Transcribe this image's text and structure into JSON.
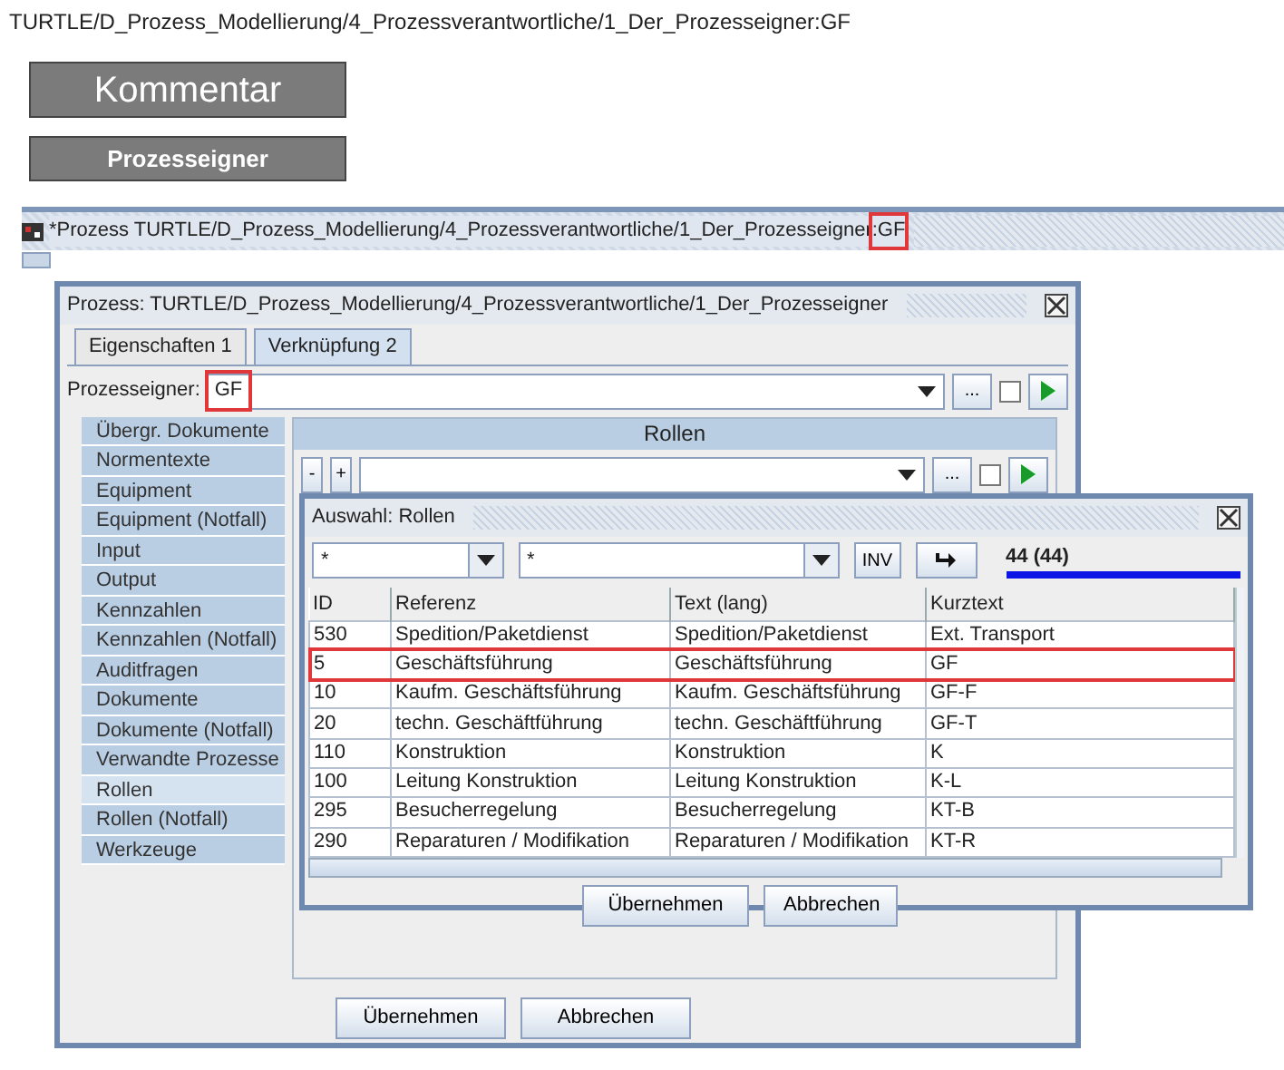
{
  "path_text": "TURTLE/D_Prozess_Modellierung/4_Prozessverantwortliche/1_Der_Prozesseigner:GF",
  "buttons": [
    {
      "label": "Kommentar",
      "kind": "large"
    },
    {
      "label": "Prozesseigner",
      "kind": "small"
    }
  ],
  "app_window": {
    "title": [
      {
        "text": "*Prozess TURTLE/D_Prozess_Modellierung/4_Prozessverantwortliche/1_Der_Prozesseigner",
        "highlighted": false
      },
      {
        "text": ":GF",
        "highlighted": true
      }
    ]
  },
  "process_dialog": {
    "title": "Prozess: TURTLE/D_Prozess_Modellierung/4_Prozessverantwortliche/1_Der_Prozesseigner",
    "tabs": [
      {
        "label": "Eigenschaften 1",
        "selected": false
      },
      {
        "label": "Verknüpfung 2",
        "selected": true
      }
    ],
    "owner_field": {
      "label": "Prozesseigner:",
      "value": "GF",
      "highlighted": true,
      "more_button": "...",
      "checked": false
    },
    "categories": [
      {
        "label": "Übergr. Dokumente",
        "selected": false
      },
      {
        "label": "Normentexte",
        "selected": false
      },
      {
        "label": "Equipment",
        "selected": false
      },
      {
        "label": "Equipment (Notfall)",
        "selected": false
      },
      {
        "label": "Input",
        "selected": false
      },
      {
        "label": "Output",
        "selected": false
      },
      {
        "label": "Kennzahlen",
        "selected": false
      },
      {
        "label": "Kennzahlen (Notfall)",
        "selected": false
      },
      {
        "label": "Auditfragen",
        "selected": false
      },
      {
        "label": "Dokumente",
        "selected": false
      },
      {
        "label": "Dokumente (Notfall)",
        "selected": false
      },
      {
        "label": "Verwandte Prozesse",
        "selected": false
      },
      {
        "label": "Rollen",
        "selected": true
      },
      {
        "label": "Rollen (Notfall)",
        "selected": false
      },
      {
        "label": "Werkzeuge",
        "selected": false
      }
    ],
    "roles_panel": {
      "header": "Rollen",
      "minus": "-",
      "plus": "+",
      "more_button": "...",
      "checked": false
    },
    "buttons": [
      "Übernehmen",
      "Abbrechen"
    ]
  },
  "roles_dialog": {
    "title": "Auswahl: Rollen",
    "filters": [
      {
        "value": "*"
      },
      {
        "value": "*"
      }
    ],
    "inv_button": "INV",
    "count": "44 (44)",
    "progress": {
      "level": 1
    },
    "columns": [
      "ID",
      "Referenz",
      "Text (lang)",
      "Kurztext"
    ],
    "rows": [
      {
        "cells": [
          "530",
          "Spedition/Paketdienst",
          "Spedition/Paketdienst",
          "Ext. Transport"
        ],
        "highlighted": false
      },
      {
        "cells": [
          "5",
          "Geschäftsführung",
          "Geschäftsführung",
          "GF"
        ],
        "highlighted": true
      },
      {
        "cells": [
          "10",
          "Kaufm. Geschäftsführung",
          "Kaufm. Geschäftsführung",
          "GF-F"
        ],
        "highlighted": false
      },
      {
        "cells": [
          "20",
          "techn. Geschäftführung",
          "techn. Geschäftführung",
          "GF-T"
        ],
        "highlighted": false
      },
      {
        "cells": [
          "110",
          "Konstruktion",
          "Konstruktion",
          "K"
        ],
        "highlighted": false
      },
      {
        "cells": [
          "100",
          "Leitung Konstruktion",
          "Leitung Konstruktion",
          "K-L"
        ],
        "highlighted": false
      },
      {
        "cells": [
          "295",
          "Besucherregelung",
          "Besucherregelung",
          "KT-B"
        ],
        "highlighted": false
      },
      {
        "cells": [
          "290",
          "Reparaturen / Modifikation",
          "Reparaturen / Modifikation",
          "KT-R"
        ],
        "highlighted": false
      }
    ],
    "buttons": [
      "Übernehmen",
      "Abbrechen"
    ]
  }
}
